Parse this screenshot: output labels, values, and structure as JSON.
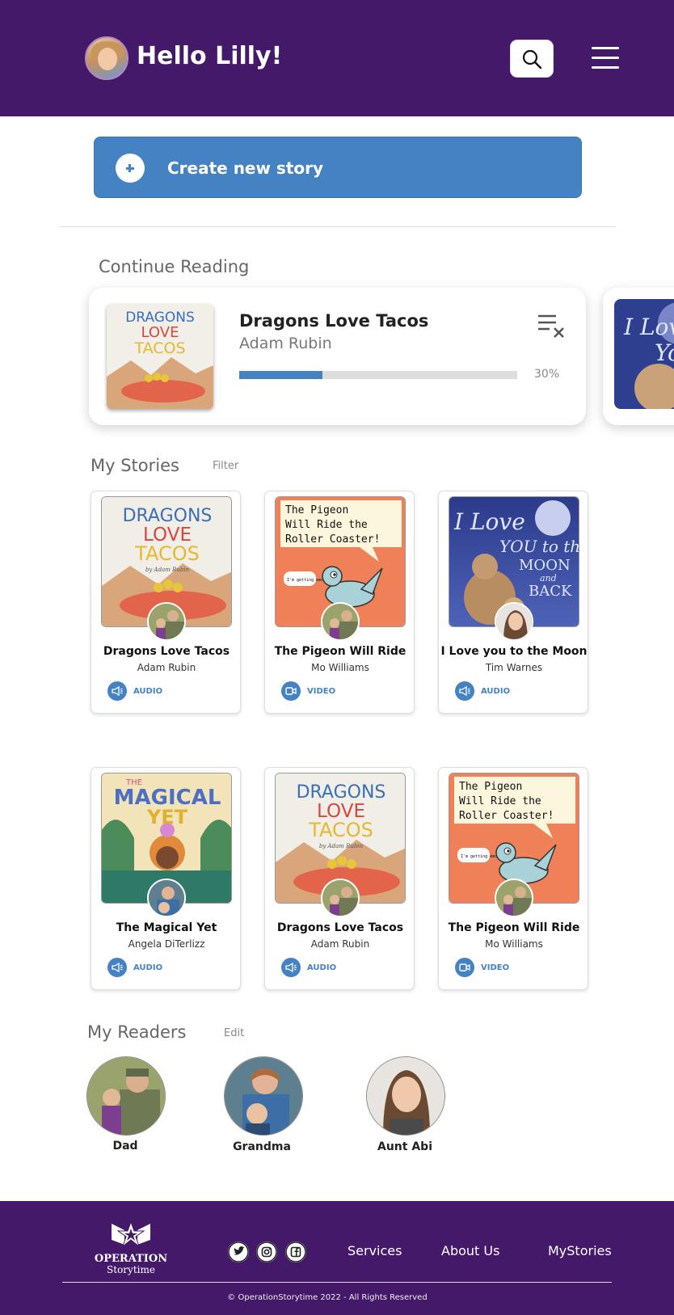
{
  "header": {
    "greeting": "Hello Lilly!",
    "avatar_icon": "child-avatar",
    "search_icon": "search-icon",
    "menu_icon": "hamburger-menu-icon",
    "background": "#44196a"
  },
  "create": {
    "label": "Create new story",
    "color": "#4482c4"
  },
  "continue_reading": {
    "title": "Continue Reading",
    "card": {
      "book_title": "Dragons Love Tacos",
      "author": "Adam Rubin",
      "progress_percent": 30,
      "progress_label": "30%",
      "cover_lines": [
        "DRAGONS",
        "LOVE",
        "TACOS"
      ]
    },
    "peek_cover_lines": [
      "I Love",
      "Yo"
    ]
  },
  "my_stories": {
    "title": "My Stories",
    "filter_label": "Filter",
    "items": [
      {
        "title": "Dragons Love Tacos",
        "author": "Adam Rubin",
        "media": "AUDIO",
        "cover": "dragons",
        "reader": "Dad"
      },
      {
        "title": "The Pigeon Will Ride",
        "author": "Mo Williams",
        "media": "VIDEO",
        "cover": "pigeon",
        "reader": "Dad"
      },
      {
        "title": "I Love you to the Moon",
        "author": "Tim Warnes",
        "media": "AUDIO",
        "cover": "moon",
        "reader": "Aunt Abi"
      },
      {
        "title": "The Magical Yet",
        "author": "Angela DiTerlizz",
        "media": "AUDIO",
        "cover": "magical",
        "reader": "Grandma"
      },
      {
        "title": "Dragons Love Tacos",
        "author": "Adam Rubin",
        "media": "AUDIO",
        "cover": "dragons",
        "reader": "Dad"
      },
      {
        "title": "The Pigeon Will Ride",
        "author": "Mo Williams",
        "media": "VIDEO",
        "cover": "pigeon",
        "reader": "Dad"
      }
    ]
  },
  "covers": {
    "dragons": {
      "lines": [
        "DRAGONS",
        "LOVE",
        "TACOS"
      ],
      "small": "by Adam Rubin"
    },
    "pigeon": {
      "lines": [
        "The Pigeon",
        "Will Ride the",
        "Roller Coaster!"
      ],
      "bubble": "I'm getting emotional!"
    },
    "moon": {
      "lines": [
        "I Love",
        "YOU to the",
        "MOON",
        "and",
        "BACK"
      ]
    },
    "magical": {
      "lines": [
        "THE",
        "MAGICAL",
        "YET"
      ]
    }
  },
  "my_readers": {
    "title": "My Readers",
    "edit_label": "Edit",
    "readers": [
      {
        "name": "Dad"
      },
      {
        "name": "Grandma"
      },
      {
        "name": "Aunt Abi"
      }
    ]
  },
  "footer": {
    "logo_line1": "OPERATION",
    "logo_line2": "Storytime",
    "social_icons": [
      "twitter-icon",
      "instagram-icon",
      "facebook-icon"
    ],
    "links": [
      "Services",
      "About Us",
      "MyStories"
    ],
    "copyright": "© OperationStorytime 2022 - All Rights Reserved"
  }
}
